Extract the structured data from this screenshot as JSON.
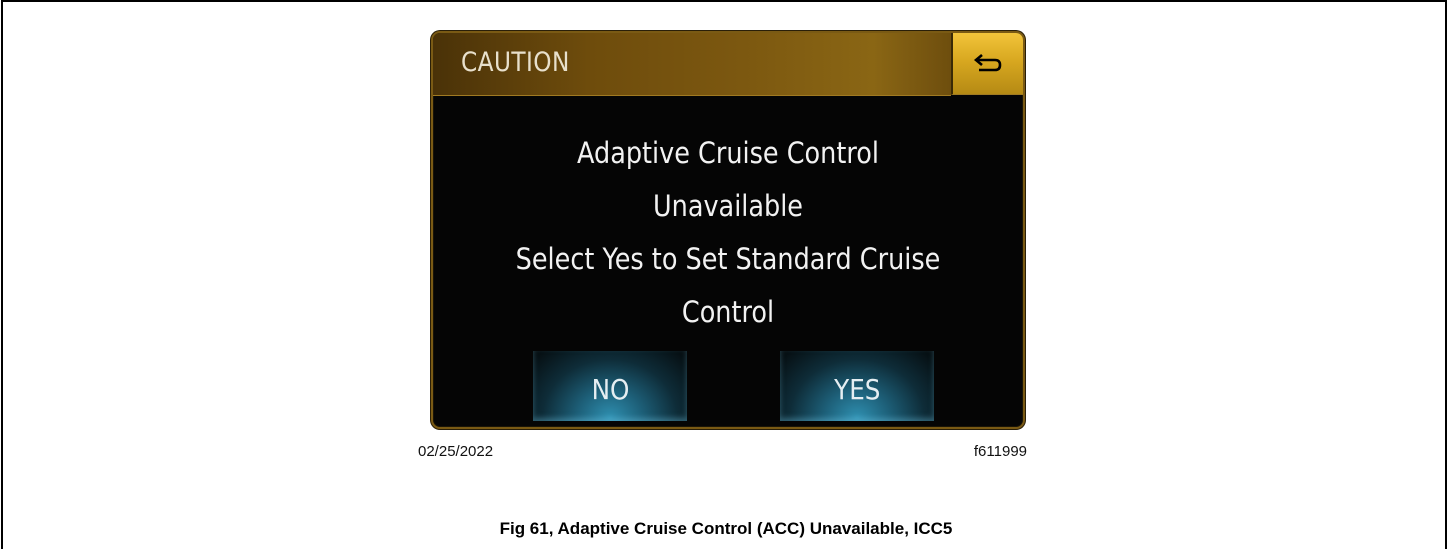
{
  "screen": {
    "title": "CAUTION",
    "back_icon": "back-arrow-icon",
    "message_lines": [
      "Adaptive Cruise Control",
      "Unavailable",
      "Select Yes to Set Standard Cruise",
      "Control"
    ],
    "no_label": "NO",
    "yes_label": "YES",
    "colors": {
      "title_bar": "#7c5810",
      "back_button": "#d8a820",
      "button_glow": "#2f8fb0",
      "screen_bg": "#050505"
    }
  },
  "figure": {
    "date": "02/25/2022",
    "code": "f611999",
    "caption": "Fig 61, Adaptive Cruise Control (ACC) Unavailable, ICC5"
  }
}
